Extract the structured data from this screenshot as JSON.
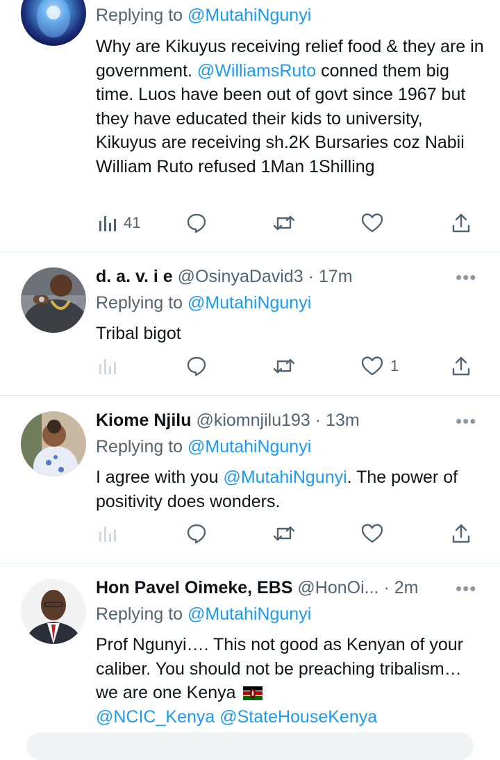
{
  "tweets": [
    {
      "replying_prefix": "Replying to",
      "replying_handle": "@MutahiNgunyi",
      "body_segments": [
        {
          "text": "Why are Kikuyus receiving relief food & they are in government. ",
          "mention": false
        },
        {
          "text": "@WilliamsRuto",
          "mention": true
        },
        {
          "text": " conned them big time. Luos have been out of govt since 1967 but they have educated their kids to university, Kikuyus are receiving sh.2K Bursaries coz Nabii William Ruto refused 1Man 1Shilling",
          "mention": false
        }
      ],
      "views": "41",
      "likes": ""
    },
    {
      "name": "d. a. v. i e",
      "handle": "@OsinyaDavid3",
      "time": "· 17m",
      "replying_prefix": "Replying to",
      "replying_handle": "@MutahiNgunyi",
      "body": "Tribal bigot",
      "views": "",
      "likes": "1"
    },
    {
      "name": "Kiome Njilu",
      "handle": "@kiomnjilu193",
      "time": "· 13m",
      "replying_prefix": "Replying to",
      "replying_handle": "@MutahiNgunyi",
      "body_pre": "I agree with you ",
      "body_mention": "@MutahiNgunyi",
      "body_post": ". The power of positivity does wonders.",
      "views": "",
      "likes": ""
    },
    {
      "name": "Hon Pavel Oimeke, EBS",
      "handle": "@HonOi...",
      "time": "· 2m",
      "replying_prefix": "Replying to",
      "replying_handle": "@MutahiNgunyi",
      "body": "Prof Ngunyi…. This not good as Kenyan of your caliber. You should not be preaching tribalism… we are one Kenya",
      "body_mentions": "@NCIC_Kenya @StateHouseKenya"
    }
  ],
  "more_glyph": "•••",
  "icons": {
    "views": "analytics-icon",
    "reply": "reply-icon",
    "retweet": "retweet-icon",
    "like": "heart-icon",
    "share": "share-icon",
    "flag": "kenya-flag-icon"
  },
  "colors": {
    "link": "#1d9bf0",
    "secondary": "#536471",
    "text": "#0f1419",
    "divider": "#e6ebef"
  }
}
